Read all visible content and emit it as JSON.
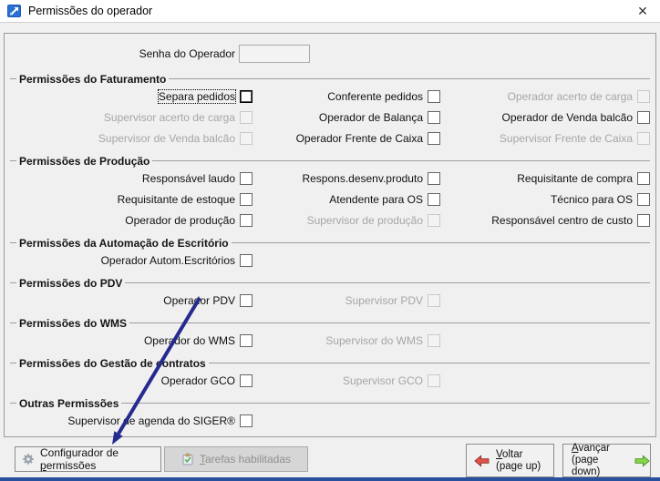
{
  "window": {
    "title": "Permissões do operador",
    "close_glyph": "✕"
  },
  "form": {
    "password_label": "Senha do Operador",
    "password_value": ""
  },
  "sections": [
    {
      "title": "Permissões do Faturamento",
      "rows": [
        [
          {
            "label": "Separa pedidos",
            "enabled": true,
            "focused": true,
            "checked": false
          },
          {
            "label": "Conferente pedidos",
            "enabled": true,
            "checked": false
          },
          {
            "label": "Operador acerto de carga",
            "enabled": false,
            "checked": false
          }
        ],
        [
          {
            "label": "Supervisor acerto de carga",
            "enabled": false,
            "checked": false
          },
          {
            "label": "Operador de Balança",
            "enabled": true,
            "checked": false
          },
          {
            "label": "Operador de Venda balcão",
            "enabled": true,
            "checked": false
          }
        ],
        [
          {
            "label": "Supervisor de Venda balcão",
            "enabled": false,
            "checked": false
          },
          {
            "label": "Operador Frente de Caixa",
            "enabled": true,
            "checked": false
          },
          {
            "label": "Supervisor Frente de Caixa",
            "enabled": false,
            "checked": false
          }
        ]
      ]
    },
    {
      "title": "Permissões de Produção",
      "rows": [
        [
          {
            "label": "Responsável laudo",
            "enabled": true,
            "checked": false
          },
          {
            "label": "Respons.desenv.produto",
            "enabled": true,
            "checked": false
          },
          {
            "label": "Requisitante de compra",
            "enabled": true,
            "checked": false
          }
        ],
        [
          {
            "label": "Requisitante de estoque",
            "enabled": true,
            "checked": false
          },
          {
            "label": "Atendente para OS",
            "enabled": true,
            "checked": false
          },
          {
            "label": "Técnico para OS",
            "enabled": true,
            "checked": false
          }
        ],
        [
          {
            "label": "Operador de produção",
            "enabled": true,
            "checked": false
          },
          {
            "label": "Supervisor de produção",
            "enabled": false,
            "checked": false
          },
          {
            "label": "Responsável centro de custo",
            "enabled": true,
            "checked": false
          }
        ]
      ]
    },
    {
      "title": "Permissões da Automação de Escritório",
      "rows": [
        [
          {
            "label": "Operador Autom.Escritórios",
            "enabled": true,
            "checked": false
          },
          null,
          null
        ]
      ]
    },
    {
      "title": "Permissões do PDV",
      "rows": [
        [
          {
            "label": "Operador PDV",
            "enabled": true,
            "checked": false
          },
          {
            "label": "Supervisor PDV",
            "enabled": false,
            "checked": false
          },
          null
        ]
      ]
    },
    {
      "title": "Permissões do WMS",
      "rows": [
        [
          {
            "label": "Operador do WMS",
            "enabled": true,
            "checked": false
          },
          {
            "label": "Supervisor do WMS",
            "enabled": false,
            "checked": false
          },
          null
        ]
      ]
    },
    {
      "title": "Permissões do Gestão de contratos",
      "rows": [
        [
          {
            "label": "Operador GCO",
            "enabled": true,
            "checked": false
          },
          {
            "label": "Supervisor GCO",
            "enabled": false,
            "checked": false
          },
          null
        ]
      ]
    },
    {
      "title": "Outras Permissões",
      "rows": [
        [
          {
            "label": "Supervisor de agenda do SIGER®",
            "enabled": true,
            "checked": false
          },
          null,
          null
        ]
      ]
    }
  ],
  "footer": {
    "configurador": {
      "pre": "Configurador de ",
      "u": "p",
      "post": "ermissões"
    },
    "tarefas": {
      "pre": "",
      "u": "T",
      "post": "arefas habilitadas"
    },
    "voltar": {
      "u": "V",
      "post": "oltar",
      "line2": "(page up)"
    },
    "avancar": {
      "u": "A",
      "post": "vançar",
      "line2": "(page down)"
    }
  },
  "colors": {
    "titlebar_bg": "#ffffff",
    "dialog_bg": "#f0f0f0",
    "disabled_text": "#a6a6a6",
    "annotation_arrow": "#252a8e",
    "voltar_arrow": "#e1524a",
    "avancar_arrow": "#86d64b",
    "bottom_edge": "#28509e"
  }
}
